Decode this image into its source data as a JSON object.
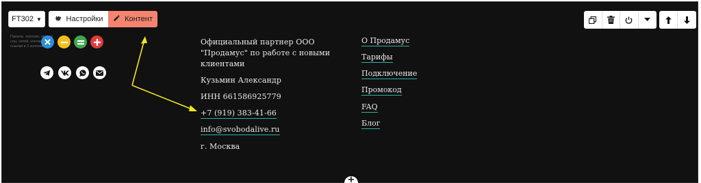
{
  "toolbar_left": {
    "block_label": "FT302",
    "settings_label": "Настройки",
    "content_label": "Контент"
  },
  "toolbar_right": {
    "buttons": [
      "duplicate-icon",
      "trash-icon",
      "power-icon",
      "caret-down-icon",
      "arrow-up-icon",
      "arrow-down-icon"
    ]
  },
  "hint_text": "Панель: логотип, иконки соц. сетей, контакты и ссылки в 3 колонки",
  "circle_buttons": [
    {
      "name": "remove",
      "color": "#2d8fd8"
    },
    {
      "name": "minimize",
      "color": "#f2c019"
    },
    {
      "name": "equal",
      "color": "#3fa84d"
    },
    {
      "name": "add",
      "color": "#e13b3b"
    }
  ],
  "social": [
    "telegram-icon",
    "vk-icon",
    "whatsapp-icon",
    "mail-icon"
  ],
  "info": {
    "partner": "Официальный партнер ООО \"Продамус\" по работе с новыми клиентами",
    "name": "Кузьмин Александр",
    "inn": "ИНН 661586925779",
    "phone": "+7 (919) 383-41-66",
    "email": "info@svobodalive.ru",
    "city": "г. Москва"
  },
  "nav": {
    "links": [
      "О Продамус",
      "Тарифы",
      "Подключение",
      "Промокод",
      "FAQ",
      "Блог"
    ]
  },
  "colors": {
    "background": "#111111",
    "accent_button": "#f5846e",
    "link_underline": "#2bb3a0",
    "annotation_arrow": "#f2e620"
  }
}
